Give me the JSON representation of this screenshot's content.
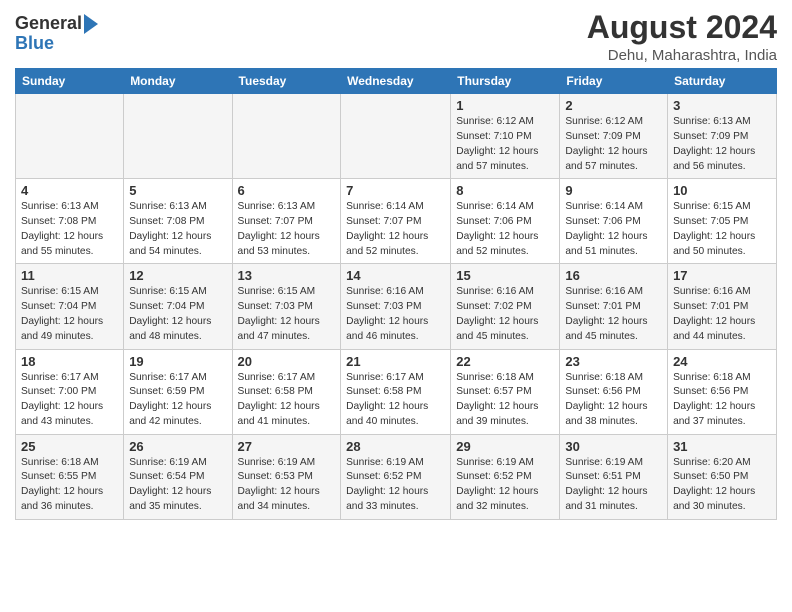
{
  "header": {
    "logo_general": "General",
    "logo_blue": "Blue",
    "month_year": "August 2024",
    "location": "Dehu, Maharashtra, India"
  },
  "days_of_week": [
    "Sunday",
    "Monday",
    "Tuesday",
    "Wednesday",
    "Thursday",
    "Friday",
    "Saturday"
  ],
  "weeks": [
    [
      {
        "day": "",
        "info": ""
      },
      {
        "day": "",
        "info": ""
      },
      {
        "day": "",
        "info": ""
      },
      {
        "day": "",
        "info": ""
      },
      {
        "day": "1",
        "info": "Sunrise: 6:12 AM\nSunset: 7:10 PM\nDaylight: 12 hours\nand 57 minutes."
      },
      {
        "day": "2",
        "info": "Sunrise: 6:12 AM\nSunset: 7:09 PM\nDaylight: 12 hours\nand 57 minutes."
      },
      {
        "day": "3",
        "info": "Sunrise: 6:13 AM\nSunset: 7:09 PM\nDaylight: 12 hours\nand 56 minutes."
      }
    ],
    [
      {
        "day": "4",
        "info": "Sunrise: 6:13 AM\nSunset: 7:08 PM\nDaylight: 12 hours\nand 55 minutes."
      },
      {
        "day": "5",
        "info": "Sunrise: 6:13 AM\nSunset: 7:08 PM\nDaylight: 12 hours\nand 54 minutes."
      },
      {
        "day": "6",
        "info": "Sunrise: 6:13 AM\nSunset: 7:07 PM\nDaylight: 12 hours\nand 53 minutes."
      },
      {
        "day": "7",
        "info": "Sunrise: 6:14 AM\nSunset: 7:07 PM\nDaylight: 12 hours\nand 52 minutes."
      },
      {
        "day": "8",
        "info": "Sunrise: 6:14 AM\nSunset: 7:06 PM\nDaylight: 12 hours\nand 52 minutes."
      },
      {
        "day": "9",
        "info": "Sunrise: 6:14 AM\nSunset: 7:06 PM\nDaylight: 12 hours\nand 51 minutes."
      },
      {
        "day": "10",
        "info": "Sunrise: 6:15 AM\nSunset: 7:05 PM\nDaylight: 12 hours\nand 50 minutes."
      }
    ],
    [
      {
        "day": "11",
        "info": "Sunrise: 6:15 AM\nSunset: 7:04 PM\nDaylight: 12 hours\nand 49 minutes."
      },
      {
        "day": "12",
        "info": "Sunrise: 6:15 AM\nSunset: 7:04 PM\nDaylight: 12 hours\nand 48 minutes."
      },
      {
        "day": "13",
        "info": "Sunrise: 6:15 AM\nSunset: 7:03 PM\nDaylight: 12 hours\nand 47 minutes."
      },
      {
        "day": "14",
        "info": "Sunrise: 6:16 AM\nSunset: 7:03 PM\nDaylight: 12 hours\nand 46 minutes."
      },
      {
        "day": "15",
        "info": "Sunrise: 6:16 AM\nSunset: 7:02 PM\nDaylight: 12 hours\nand 45 minutes."
      },
      {
        "day": "16",
        "info": "Sunrise: 6:16 AM\nSunset: 7:01 PM\nDaylight: 12 hours\nand 45 minutes."
      },
      {
        "day": "17",
        "info": "Sunrise: 6:16 AM\nSunset: 7:01 PM\nDaylight: 12 hours\nand 44 minutes."
      }
    ],
    [
      {
        "day": "18",
        "info": "Sunrise: 6:17 AM\nSunset: 7:00 PM\nDaylight: 12 hours\nand 43 minutes."
      },
      {
        "day": "19",
        "info": "Sunrise: 6:17 AM\nSunset: 6:59 PM\nDaylight: 12 hours\nand 42 minutes."
      },
      {
        "day": "20",
        "info": "Sunrise: 6:17 AM\nSunset: 6:58 PM\nDaylight: 12 hours\nand 41 minutes."
      },
      {
        "day": "21",
        "info": "Sunrise: 6:17 AM\nSunset: 6:58 PM\nDaylight: 12 hours\nand 40 minutes."
      },
      {
        "day": "22",
        "info": "Sunrise: 6:18 AM\nSunset: 6:57 PM\nDaylight: 12 hours\nand 39 minutes."
      },
      {
        "day": "23",
        "info": "Sunrise: 6:18 AM\nSunset: 6:56 PM\nDaylight: 12 hours\nand 38 minutes."
      },
      {
        "day": "24",
        "info": "Sunrise: 6:18 AM\nSunset: 6:56 PM\nDaylight: 12 hours\nand 37 minutes."
      }
    ],
    [
      {
        "day": "25",
        "info": "Sunrise: 6:18 AM\nSunset: 6:55 PM\nDaylight: 12 hours\nand 36 minutes."
      },
      {
        "day": "26",
        "info": "Sunrise: 6:19 AM\nSunset: 6:54 PM\nDaylight: 12 hours\nand 35 minutes."
      },
      {
        "day": "27",
        "info": "Sunrise: 6:19 AM\nSunset: 6:53 PM\nDaylight: 12 hours\nand 34 minutes."
      },
      {
        "day": "28",
        "info": "Sunrise: 6:19 AM\nSunset: 6:52 PM\nDaylight: 12 hours\nand 33 minutes."
      },
      {
        "day": "29",
        "info": "Sunrise: 6:19 AM\nSunset: 6:52 PM\nDaylight: 12 hours\nand 32 minutes."
      },
      {
        "day": "30",
        "info": "Sunrise: 6:19 AM\nSunset: 6:51 PM\nDaylight: 12 hours\nand 31 minutes."
      },
      {
        "day": "31",
        "info": "Sunrise: 6:20 AM\nSunset: 6:50 PM\nDaylight: 12 hours\nand 30 minutes."
      }
    ]
  ]
}
